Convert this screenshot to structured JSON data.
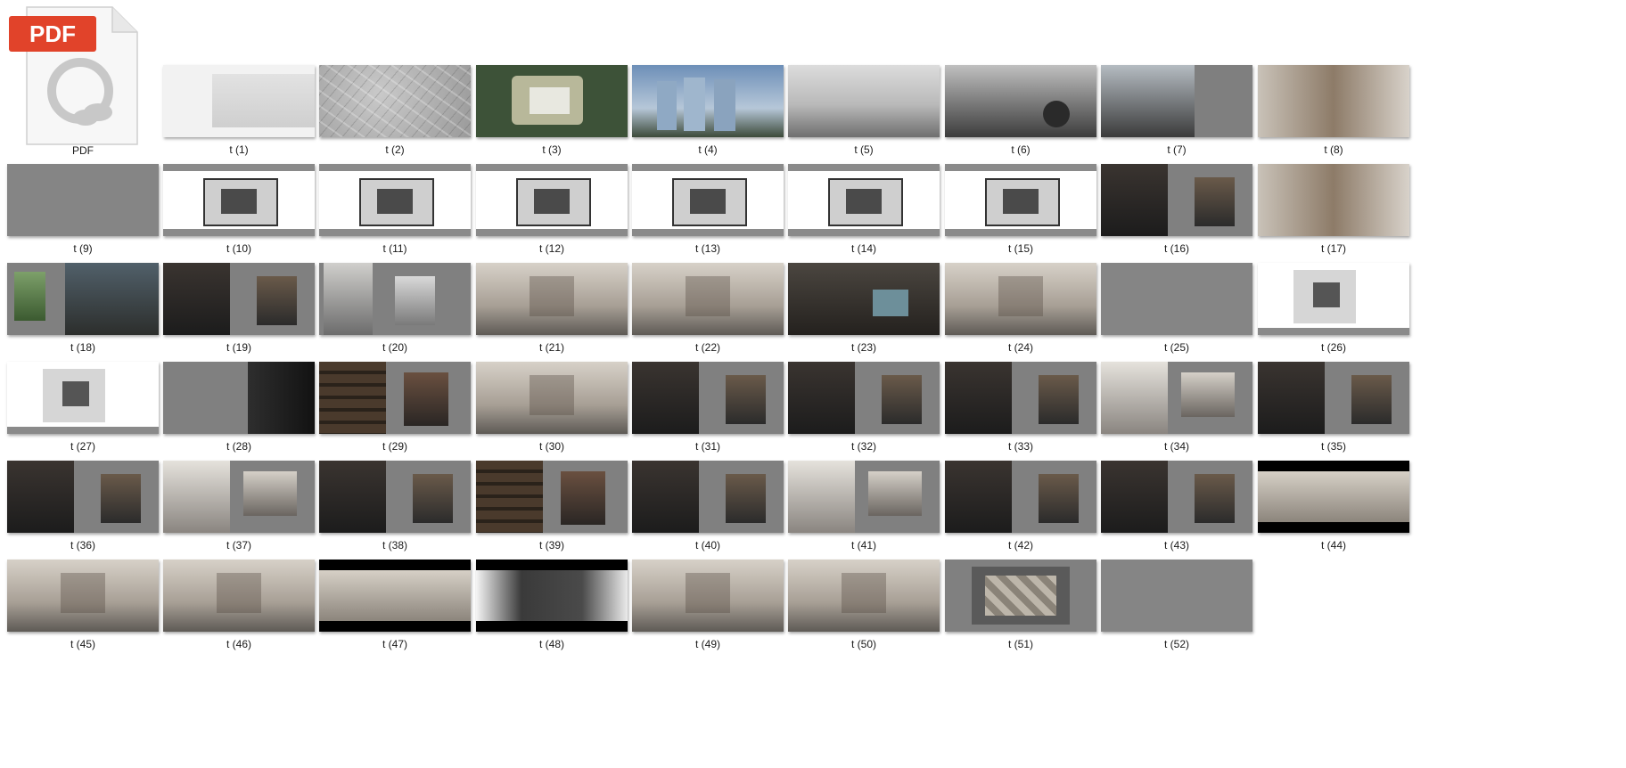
{
  "pdf_item": {
    "badge": "PDF",
    "label": "PDF",
    "accent": "#e1432a"
  },
  "items": [
    {
      "label": "t (1)",
      "style": "cover"
    },
    {
      "label": "t (2)",
      "style": "map"
    },
    {
      "label": "t (3)",
      "style": "aerial"
    },
    {
      "label": "t (4)",
      "style": "towers"
    },
    {
      "label": "t (5)",
      "style": "landscape"
    },
    {
      "label": "t (6)",
      "style": "landscape-dark"
    },
    {
      "label": "t (7)",
      "style": "photo-split"
    },
    {
      "label": "t (8)",
      "style": "interior-warm"
    },
    {
      "label": "t (9)",
      "style": "gray"
    },
    {
      "label": "t (10)",
      "style": "plan"
    },
    {
      "label": "t (11)",
      "style": "plan"
    },
    {
      "label": "t (12)",
      "style": "plan"
    },
    {
      "label": "t (13)",
      "style": "plan"
    },
    {
      "label": "t (14)",
      "style": "plan"
    },
    {
      "label": "t (15)",
      "style": "plan"
    },
    {
      "label": "t (16)",
      "style": "dark-split"
    },
    {
      "label": "t (17)",
      "style": "interior-warm"
    },
    {
      "label": "t (18)",
      "style": "green-split"
    },
    {
      "label": "t (19)",
      "style": "dark-split"
    },
    {
      "label": "t (20)",
      "style": "gray-split"
    },
    {
      "label": "t (21)",
      "style": "interior-light"
    },
    {
      "label": "t (22)",
      "style": "interior-light"
    },
    {
      "label": "t (23)",
      "style": "interior-dark"
    },
    {
      "label": "t (24)",
      "style": "interior-light"
    },
    {
      "label": "t (25)",
      "style": "gray"
    },
    {
      "label": "t (26)",
      "style": "plan-white"
    },
    {
      "label": "t (27)",
      "style": "plan-white"
    },
    {
      "label": "t (28)",
      "style": "door"
    },
    {
      "label": "t (29)",
      "style": "shelf-split"
    },
    {
      "label": "t (30)",
      "style": "interior-light"
    },
    {
      "label": "t (31)",
      "style": "dark-split"
    },
    {
      "label": "t (32)",
      "style": "dark-split"
    },
    {
      "label": "t (33)",
      "style": "dark-split"
    },
    {
      "label": "t (34)",
      "style": "light-split"
    },
    {
      "label": "t (35)",
      "style": "dark-split"
    },
    {
      "label": "t (36)",
      "style": "dark-split"
    },
    {
      "label": "t (37)",
      "style": "light-split"
    },
    {
      "label": "t (38)",
      "style": "dark-split"
    },
    {
      "label": "t (39)",
      "style": "shelf-split"
    },
    {
      "label": "t (40)",
      "style": "dark-split"
    },
    {
      "label": "t (41)",
      "style": "light-split"
    },
    {
      "label": "t (42)",
      "style": "dark-split"
    },
    {
      "label": "t (43)",
      "style": "dark-split"
    },
    {
      "label": "t (44)",
      "style": "cinema"
    },
    {
      "label": "t (45)",
      "style": "interior-light"
    },
    {
      "label": "t (46)",
      "style": "interior-light"
    },
    {
      "label": "t (47)",
      "style": "cinema"
    },
    {
      "label": "t (48)",
      "style": "cinema-dark"
    },
    {
      "label": "t (49)",
      "style": "interior-light"
    },
    {
      "label": "t (50)",
      "style": "interior-light"
    },
    {
      "label": "t (51)",
      "style": "material"
    },
    {
      "label": "t (52)",
      "style": "gray"
    }
  ]
}
